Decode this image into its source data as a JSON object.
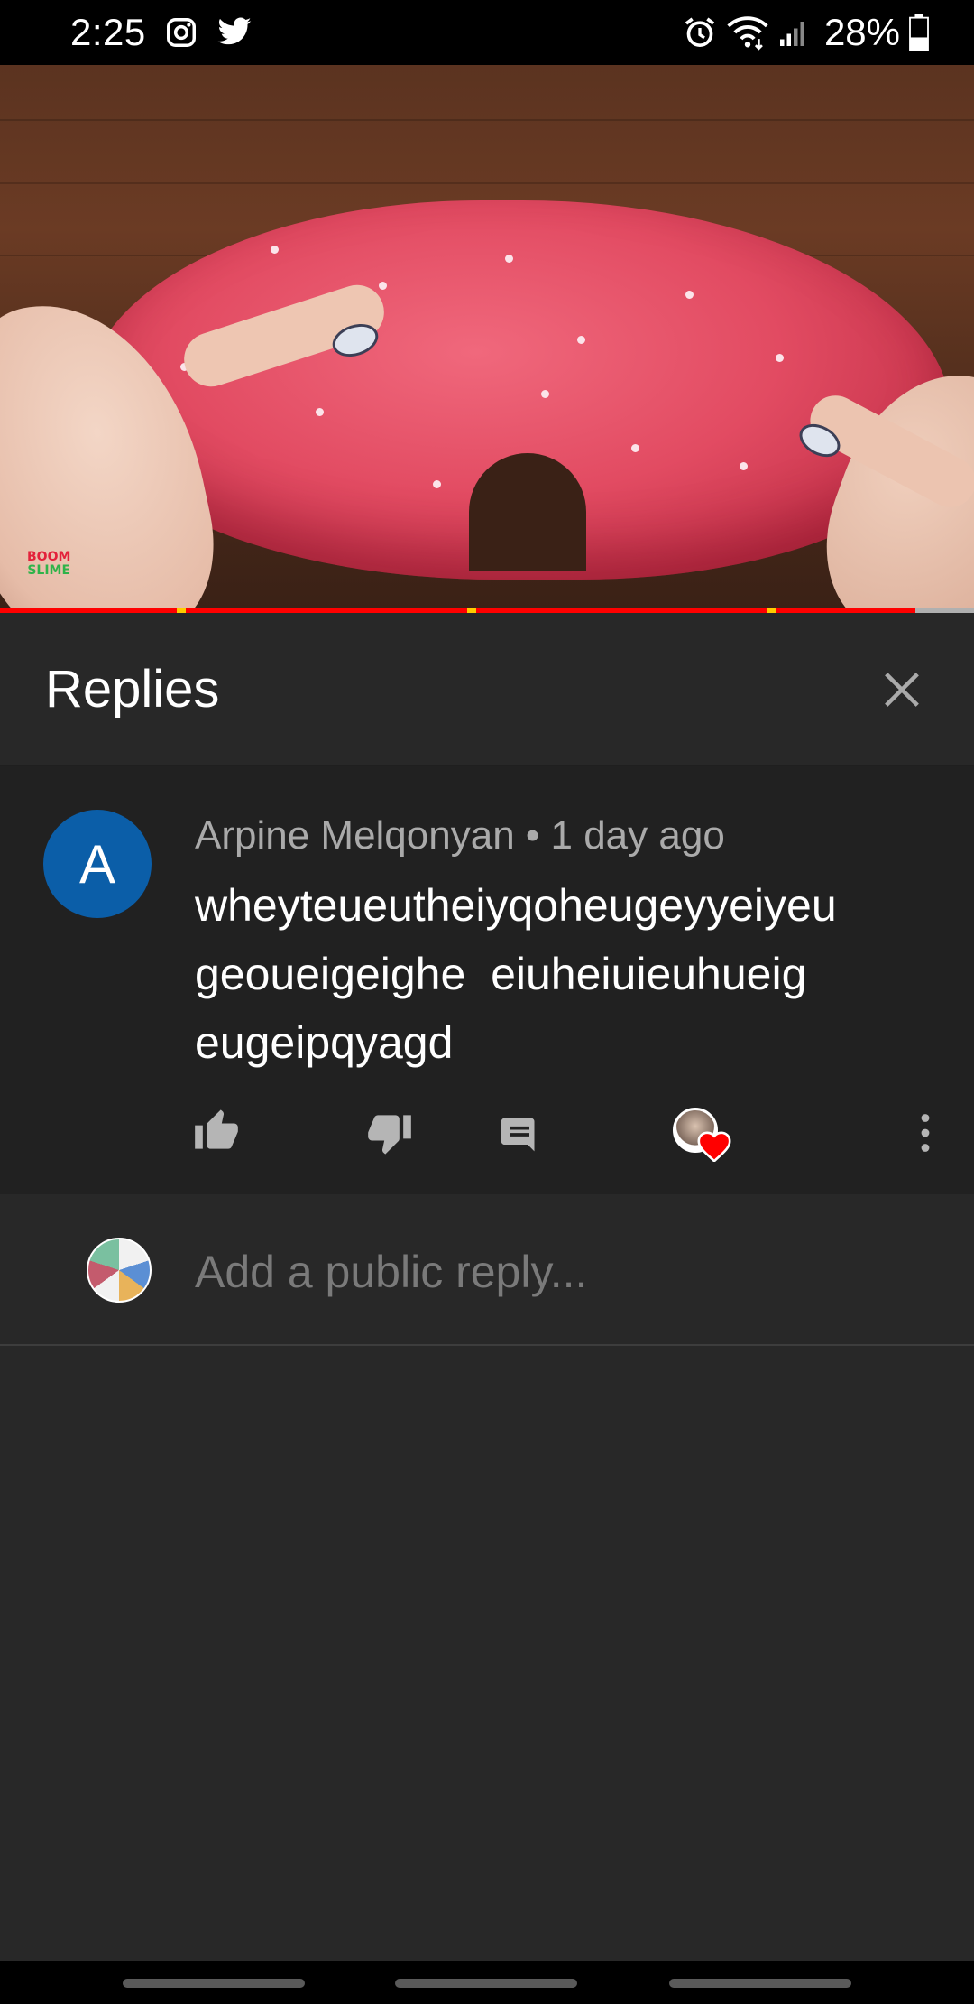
{
  "status_bar": {
    "time": "2:25",
    "battery": "28%",
    "left_icons": [
      "instagram-icon",
      "twitter-icon"
    ],
    "right_icons": [
      "alarm-icon",
      "wifi-icon",
      "signal-icon",
      "battery-icon"
    ]
  },
  "video": {
    "channel_logo_line1": "BOOM",
    "channel_logo_line2": "SLIME",
    "progress": 0.94,
    "colors": {
      "progress": "#ff0000",
      "ad_marker": "#ffcc00",
      "track": "#b0b0b0"
    }
  },
  "replies_panel": {
    "title": "Replies",
    "close_icon": "close-icon"
  },
  "comment": {
    "avatar_letter": "A",
    "avatar_color": "#0b5ea8",
    "meta": "Arpine Melqonyan • 1 day ago",
    "text_lines": [
      "wheyteueutheiyqoheugeyyeiyeu",
      "geoueigeighe  eiuheiuieuhueig",
      "eugeipqyagd"
    ],
    "actions": [
      "thumb-up-icon",
      "thumb-down-icon",
      "reply-icon",
      "creator-heart",
      "more-vert-icon"
    ]
  },
  "add_reply": {
    "placeholder": "Add a public reply..."
  },
  "colors": {
    "background": "#282828",
    "comment_background": "#212121",
    "heart": "#ff0000"
  }
}
